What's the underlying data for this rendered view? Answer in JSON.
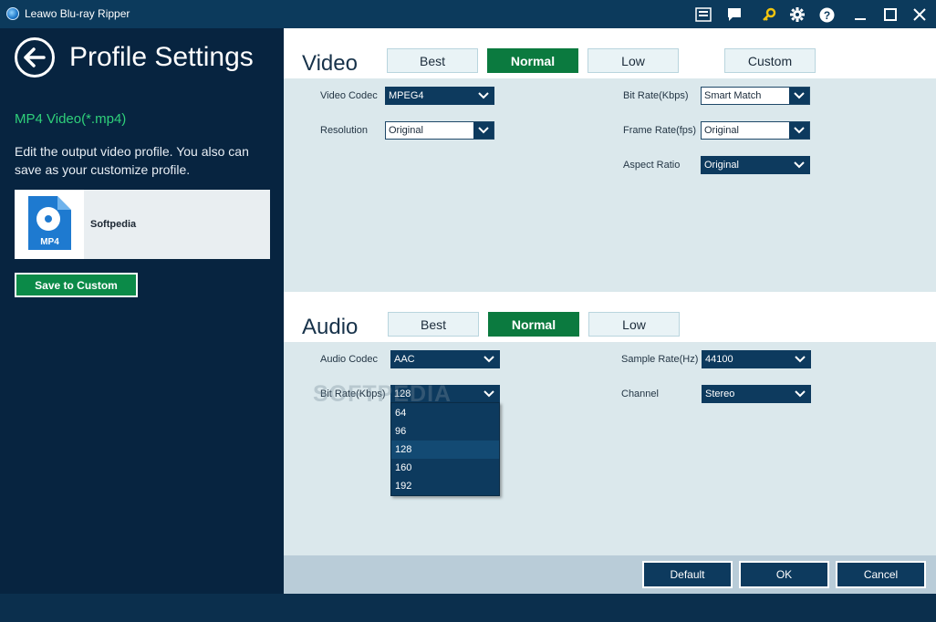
{
  "window": {
    "title": "Leawo Blu-ray Ripper",
    "controls": [
      "screenshot-icon",
      "message-icon",
      "key-icon",
      "gear-icon",
      "help-icon",
      "minimize-icon",
      "maximize-icon",
      "close-icon"
    ]
  },
  "sidebar": {
    "title": "Profile Settings",
    "profile_name": "MP4 Video(*.mp4)",
    "description": "Edit the output video profile. You also can save as your customize profile.",
    "card_icon_label": "MP4",
    "card_name": "Softpedia",
    "save_label": "Save to Custom"
  },
  "video": {
    "title": "Video",
    "presets": [
      "Best",
      "Normal",
      "Low",
      "Custom"
    ],
    "active_preset": "Normal",
    "codec_label": "Video Codec",
    "codec_value": "MPEG4",
    "resolution_label": "Resolution",
    "resolution_value": "Original",
    "bitrate_label": "Bit Rate(Kbps)",
    "bitrate_value": "Smart Match",
    "framerate_label": "Frame Rate(fps)",
    "framerate_value": "Original",
    "aspect_label": "Aspect Ratio",
    "aspect_value": "Original"
  },
  "audio": {
    "title": "Audio",
    "presets": [
      "Best",
      "Normal",
      "Low"
    ],
    "active_preset": "Normal",
    "codec_label": "Audio Codec",
    "codec_value": "AAC",
    "bitrate_label": "Bit Rate(Kbps)",
    "bitrate_value": "128",
    "bitrate_options": [
      "64",
      "96",
      "128",
      "160",
      "192"
    ],
    "bitrate_selected_option": "128",
    "samplerate_label": "Sample Rate(Hz)",
    "samplerate_value": "44100",
    "channel_label": "Channel",
    "channel_value": "Stereo"
  },
  "watermark": "SOFTPEDIA",
  "actions": {
    "default_label": "Default",
    "ok_label": "OK",
    "cancel_label": "Cancel"
  },
  "colors": {
    "accent_green": "#0b7a3f",
    "navy": "#0d3a5e",
    "profile_green": "#2fd07a"
  }
}
